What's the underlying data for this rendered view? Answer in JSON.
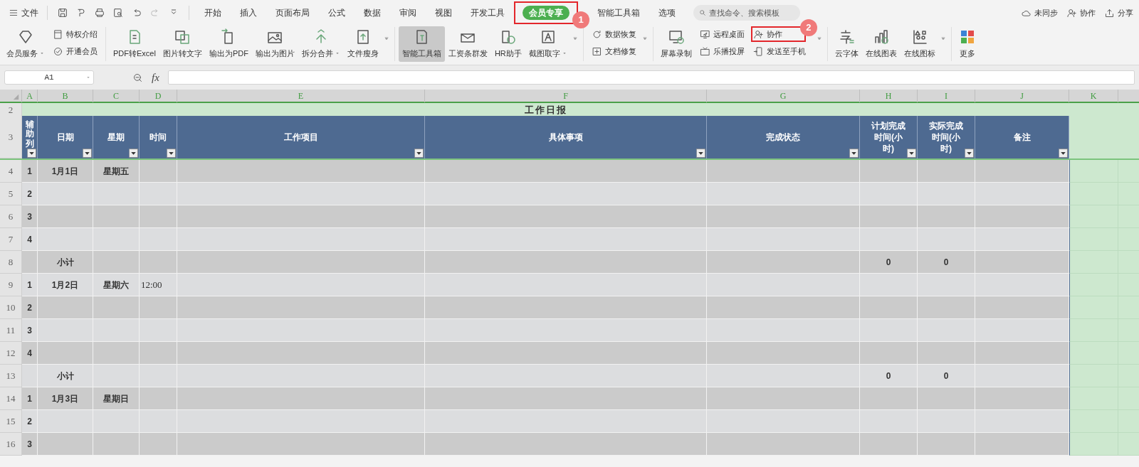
{
  "menu": {
    "label": "文件"
  },
  "tabs": [
    {
      "label": "开始",
      "selected": false
    },
    {
      "label": "插入",
      "selected": false
    },
    {
      "label": "页面布局",
      "selected": false
    },
    {
      "label": "公式",
      "selected": false
    },
    {
      "label": "数据",
      "selected": false
    },
    {
      "label": "审阅",
      "selected": false
    },
    {
      "label": "视图",
      "selected": false
    },
    {
      "label": "开发工具",
      "selected": false
    },
    {
      "label": "会员专享",
      "selected": true,
      "callout": "1"
    },
    {
      "label": "智能工具箱",
      "selected": false
    },
    {
      "label": "选项",
      "selected": false
    }
  ],
  "search": {
    "placeholder": "查找命令、搜索模板"
  },
  "top_actions": [
    "未同步",
    "协作",
    "分享"
  ],
  "ribbon": [
    {
      "kind": "large",
      "label": "会员服务",
      "dropdown": true,
      "selected": false
    },
    {
      "kind": "pair",
      "items": [
        {
          "label": "特权介绍"
        },
        {
          "label": "开通会员"
        }
      ]
    },
    {
      "kind": "separator"
    },
    {
      "kind": "large",
      "label": "PDF转Excel",
      "selected": false
    },
    {
      "kind": "large",
      "label": "图片转文字",
      "selected": false
    },
    {
      "kind": "large",
      "label": "输出为PDF",
      "selected": false
    },
    {
      "kind": "large",
      "label": "输出为图片",
      "selected": false
    },
    {
      "kind": "large",
      "label": "拆分合并",
      "dropdown": true,
      "selected": false
    },
    {
      "kind": "large",
      "label": "文件瘦身",
      "selected": false
    },
    {
      "kind": "overflow"
    },
    {
      "kind": "separator"
    },
    {
      "kind": "large",
      "label": "智能工具箱",
      "selected": true
    },
    {
      "kind": "large",
      "label": "工资条群发",
      "selected": false
    },
    {
      "kind": "large",
      "label": "HR助手",
      "selected": false
    },
    {
      "kind": "large",
      "label": "截图取字",
      "dropdown": true,
      "selected": false
    },
    {
      "kind": "overflow"
    },
    {
      "kind": "separator"
    },
    {
      "kind": "pair",
      "items": [
        {
          "label": "数据恢复"
        },
        {
          "label": "文档修复"
        }
      ]
    },
    {
      "kind": "overflow"
    },
    {
      "kind": "separator"
    },
    {
      "kind": "large",
      "label": "屏幕录制",
      "selected": false
    },
    {
      "kind": "pair",
      "items": [
        {
          "label": "远程桌面"
        },
        {
          "label": "乐播投屏"
        }
      ]
    },
    {
      "kind": "pair",
      "items": [
        {
          "label": "协作",
          "callout": "2"
        },
        {
          "label": "发送至手机"
        }
      ]
    },
    {
      "kind": "overflow"
    },
    {
      "kind": "separator"
    },
    {
      "kind": "large",
      "label": "云字体",
      "selected": false
    },
    {
      "kind": "large",
      "label": "在线图表",
      "selected": false
    },
    {
      "kind": "large",
      "label": "在线图标",
      "selected": false
    },
    {
      "kind": "overflow"
    },
    {
      "kind": "separator"
    },
    {
      "kind": "large",
      "label": "更多",
      "selected": false
    }
  ],
  "formula_bar": {
    "name_box": "A1",
    "function_label": "fx"
  },
  "sheet": {
    "columns": [
      "A",
      "B",
      "C",
      "D",
      "E",
      "F",
      "G",
      "H",
      "I",
      "J",
      "K"
    ],
    "title_row": {
      "num": "2",
      "title": "工作日报"
    },
    "header_row": {
      "num": "3",
      "headers": [
        "辅助列",
        "日期",
        "星期",
        "时间",
        "工作项目",
        "具体事项",
        "完成状态",
        "计划完成时间(小时)",
        "实际完成时间(小时)",
        "备注"
      ]
    },
    "rows": [
      {
        "num": "4",
        "cells": {
          "A": "1",
          "B": "1月1日",
          "C": "星期五"
        }
      },
      {
        "num": "5",
        "cells": {
          "A": "2"
        }
      },
      {
        "num": "6",
        "cells": {
          "A": "3"
        }
      },
      {
        "num": "7",
        "cells": {
          "A": "4"
        }
      },
      {
        "num": "8",
        "cells": {
          "B": "小计",
          "H": "0",
          "I": "0"
        }
      },
      {
        "num": "9",
        "cells": {
          "A": "1",
          "B": "1月2日",
          "C": "星期六",
          "D": "12:00"
        }
      },
      {
        "num": "10",
        "cells": {
          "A": "2"
        }
      },
      {
        "num": "11",
        "cells": {
          "A": "3"
        }
      },
      {
        "num": "12",
        "cells": {
          "A": "4"
        }
      },
      {
        "num": "13",
        "cells": {
          "B": "小计",
          "H": "0",
          "I": "0"
        }
      },
      {
        "num": "14",
        "cells": {
          "A": "1",
          "B": "1月3日",
          "C": "星期日"
        }
      },
      {
        "num": "15",
        "cells": {
          "A": "2"
        }
      },
      {
        "num": "16",
        "cells": {
          "A": "3"
        }
      }
    ]
  }
}
